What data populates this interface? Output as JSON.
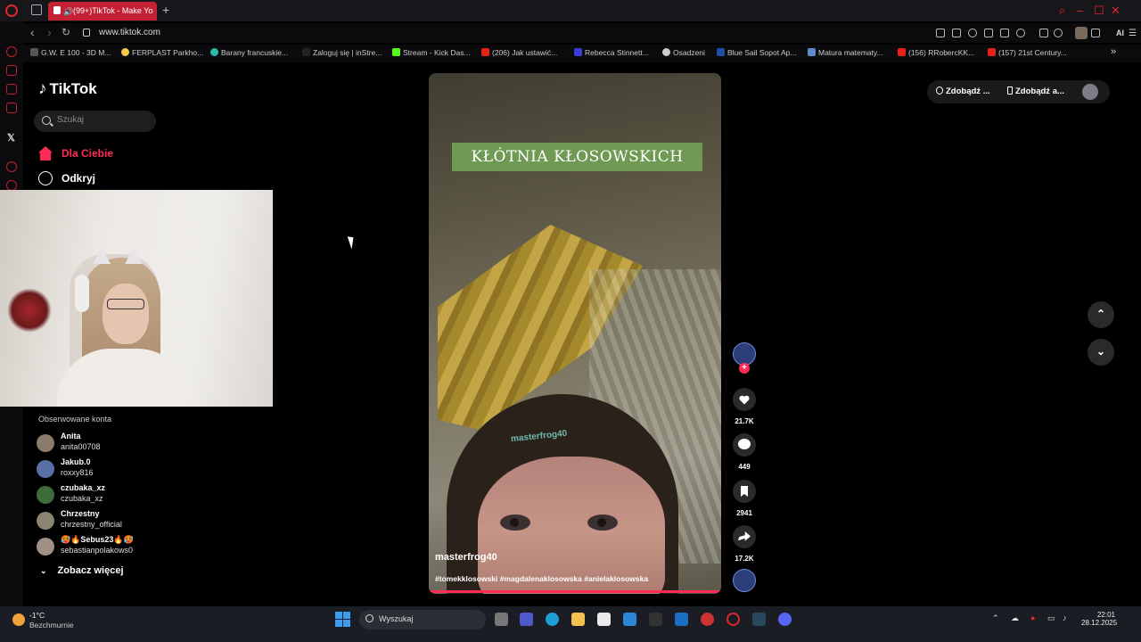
{
  "browser": {
    "tab_title": "(99+)TikTok - Make Yo",
    "url": "www.tiktok.com",
    "bookmarks": [
      "G.W. E 100 - 3D M...",
      "FERPLAST Parkho...",
      "Barany francuskie...",
      "Zaloguj się | inStre...",
      "Stream - Kick Das...",
      "(206) Jak ustawić...",
      "Rebecca Stinnett...",
      "Osadzeni",
      "Blue Sail Sopot Ap...",
      "Matura matematy...",
      "(156) RRobercKK...",
      "(157) 21st Century..."
    ],
    "ai_label": "AI"
  },
  "tiktok": {
    "logo": "TikTok",
    "search_placeholder": "Szukaj",
    "menu": {
      "for_you": "Dla Ciebie",
      "explore": "Odkryj"
    },
    "followed_title": "Obserwowane konta",
    "followed": [
      {
        "name": "Anita",
        "handle": "anita00708",
        "color": "#8b7b6b"
      },
      {
        "name": "Jakub.0",
        "handle": "roxxy816",
        "color": "#5a6fa8"
      },
      {
        "name": "czubaka_xz",
        "handle": "czubaka_xz",
        "color": "#3d6b3a"
      },
      {
        "name": "Chrzestny",
        "handle": "chrzestny_official",
        "color": "#8a8470"
      },
      {
        "name": "🥵🔥Sebus23🔥🥵",
        "handle": "sebastianpolakows0",
        "color": "#a08f85"
      }
    ],
    "see_more": "Zobacz więcej",
    "top_buttons": {
      "coins": "Zdobądź ...",
      "app": "Zdobądź a..."
    }
  },
  "video": {
    "title_overlay": "KŁÓTNIA KŁOSOWSKICH",
    "watermark": "masterfrog40",
    "author": "masterfrog40",
    "hashtags": "#tomekklosowski #magdalenaklosowska #anielaklosowska",
    "likes": "21.7K",
    "comments": "449",
    "saves": "2941",
    "shares": "17.2K"
  },
  "taskbar": {
    "temperature": "-1°C",
    "weather": "Bezchmurnie",
    "search_placeholder": "Wyszukaj",
    "time": "22:01",
    "date": "28.12.2025"
  }
}
